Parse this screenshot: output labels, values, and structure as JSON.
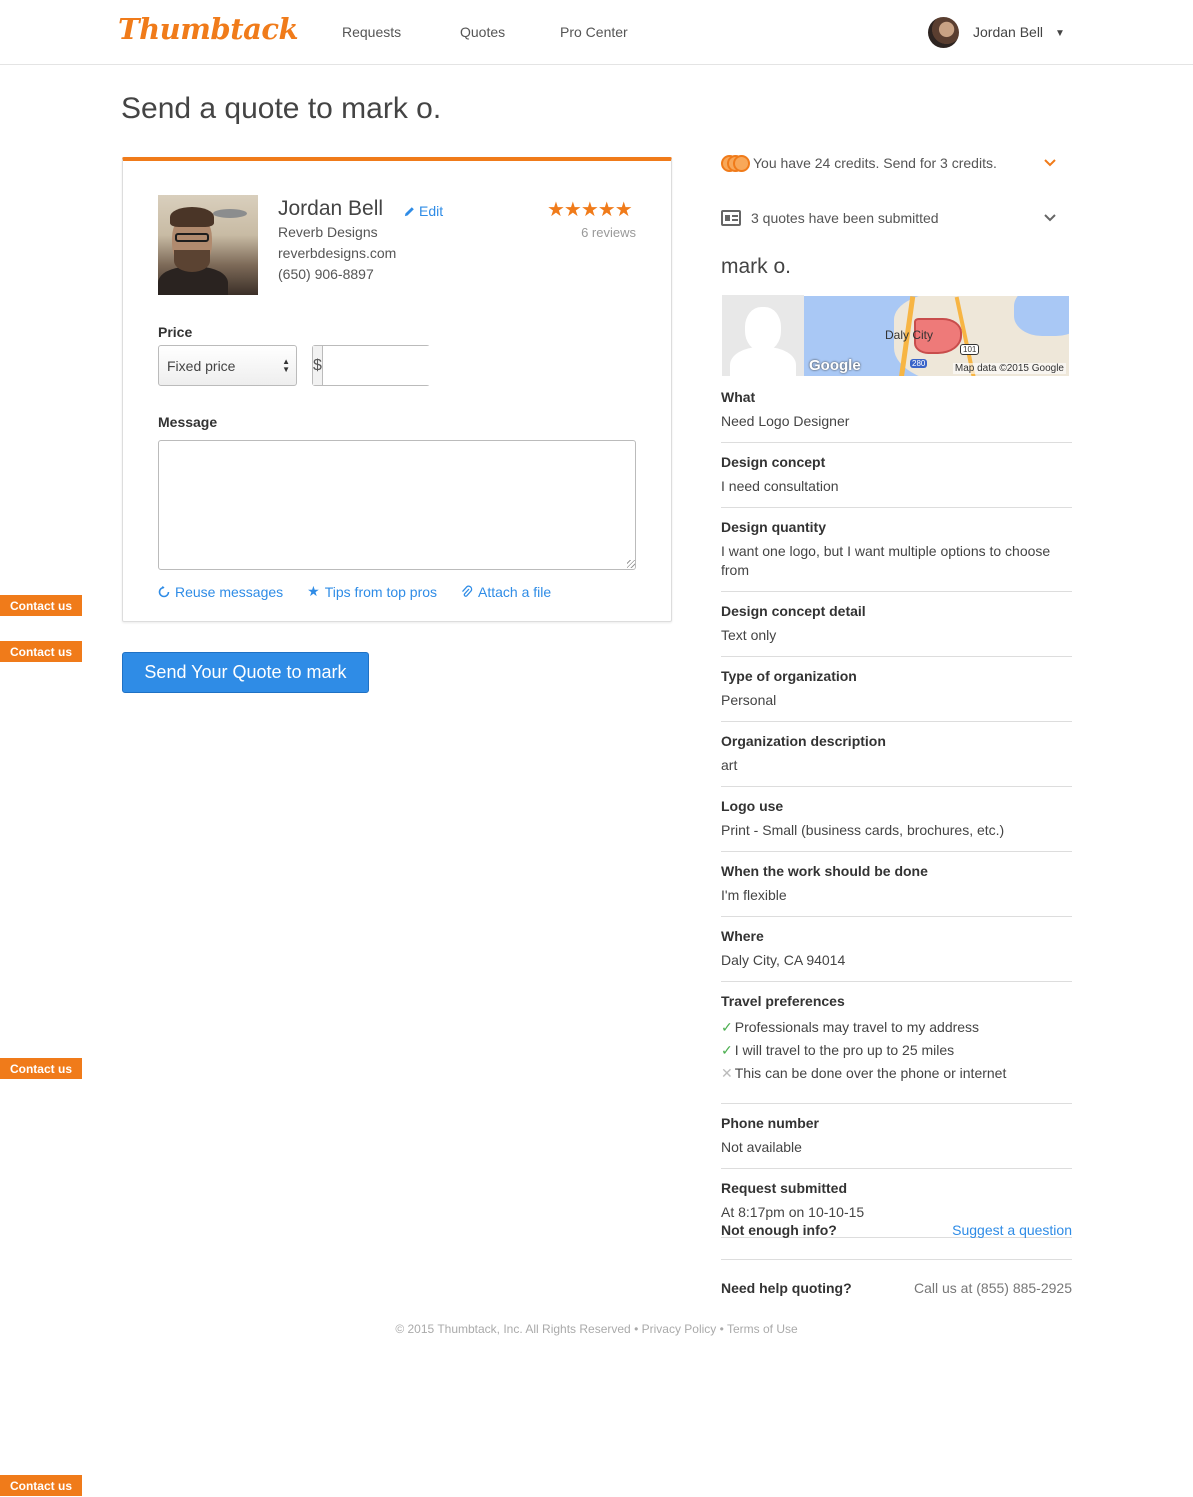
{
  "header": {
    "logo": "Thumbtack",
    "nav": [
      "Requests",
      "Quotes",
      "Pro Center"
    ],
    "user_name": "Jordan Bell",
    "caret": "▼"
  },
  "page_title": "Send a quote to mark o.",
  "pro": {
    "name": "Jordan Bell",
    "edit_label": "Edit",
    "company": "Reverb Designs",
    "website": "reverbdesigns.com",
    "phone": "(650) 906-8897",
    "stars": "★★★★★",
    "rating": 5,
    "reviews": "6 reviews"
  },
  "form": {
    "price_label": "Price",
    "price_type": "Fixed price",
    "currency": "$",
    "price_value": "",
    "message_label": "Message",
    "message_value": "",
    "links": {
      "reuse": "Reuse messages",
      "tips": "Tips from top pros",
      "attach": "Attach a file"
    },
    "send_button": "Send Your Quote to mark"
  },
  "contact_tab": "Contact us",
  "sidebar": {
    "credits_text": "You have 24 credits. Send for 3 credits.",
    "quotes_text": "3 quotes have been submitted",
    "customer_name": "mark o.",
    "map": {
      "city": "Daly City",
      "logo": "Google",
      "attribution": "Map data ©2015 Google",
      "shield_101": "101",
      "shield_280": "280"
    },
    "details": [
      {
        "label": "What",
        "value": "Need Logo Designer"
      },
      {
        "label": "Design concept",
        "value": "I need consultation"
      },
      {
        "label": "Design quantity",
        "value": "I want one logo, but I want multiple options to choose from"
      },
      {
        "label": "Design concept detail",
        "value": "Text only"
      },
      {
        "label": "Type of organization",
        "value": "Personal"
      },
      {
        "label": "Organization description",
        "value": "art"
      },
      {
        "label": "Logo use",
        "value": "Print - Small (business cards, brochures, etc.)"
      },
      {
        "label": "When the work should be done",
        "value": "I'm flexible"
      },
      {
        "label": "Where",
        "value": "Daly City, CA 94014"
      }
    ],
    "travel": {
      "label": "Travel preferences",
      "items": [
        {
          "text": "Professionals may travel to my address",
          "enabled": true
        },
        {
          "text": "I will travel to the pro up to 25 miles",
          "enabled": true
        },
        {
          "text": "This can be done over the phone or internet",
          "enabled": false
        }
      ]
    },
    "details2": [
      {
        "label": "Phone number",
        "value": "Not available"
      },
      {
        "label": "Request submitted",
        "value": "At 8:17pm on 10-10-15"
      }
    ],
    "not_enough": "Not enough info?",
    "suggest": "Suggest a question",
    "need_help": "Need help quoting?",
    "call": "Call us at (855) 885-2925"
  },
  "footer": {
    "copyright": "© 2015 Thumbtack, Inc. All Rights Reserved",
    "sep": "•",
    "privacy": "Privacy Policy",
    "terms": "Terms of Use"
  },
  "colors": {
    "brand": "#f07b1a",
    "link": "#2f8ce6",
    "button": "#2f8ce6"
  }
}
